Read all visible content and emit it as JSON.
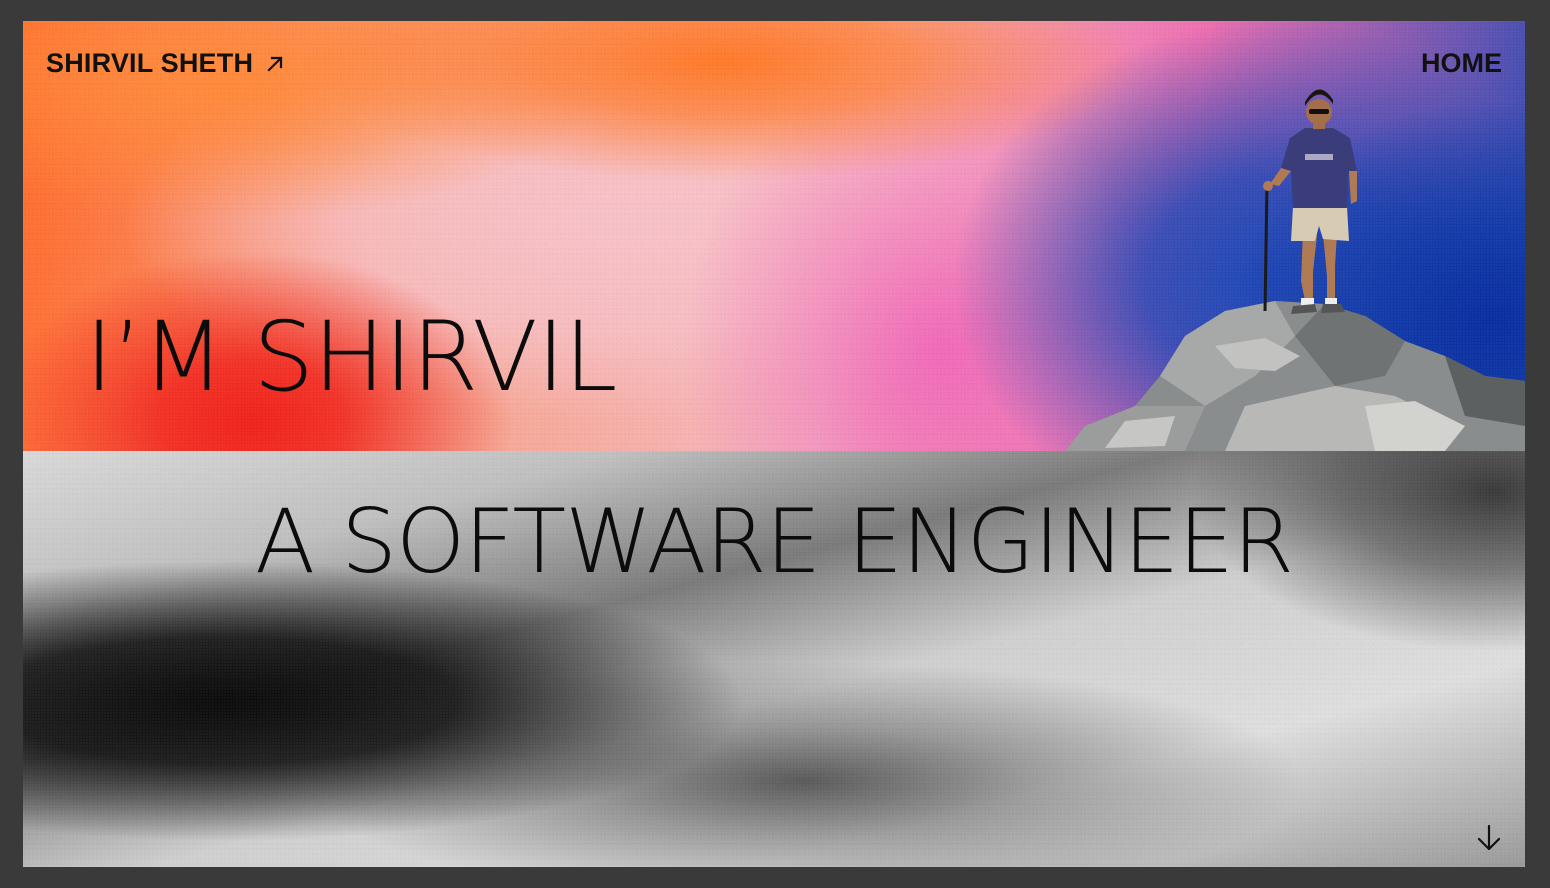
{
  "header": {
    "brand_name": "SHIRVIL SHETH",
    "brand_icon": "arrow-up-right-icon",
    "nav": [
      {
        "label": "HOME"
      }
    ]
  },
  "hero": {
    "line1": "I’M SHIRVIL",
    "line2": "A SOFTWARE ENGINEER",
    "photo": "person-standing-on-rock-with-hiking-pole",
    "scroll_icon": "arrow-down-icon"
  },
  "colors": {
    "frame": "#3a3a3a",
    "orange": "#ff7a2a",
    "red": "#f0231c",
    "pink": "#f5b9c2",
    "magenta": "#ee6fb0",
    "blue": "#1e48b6",
    "text": "#0c0c0c"
  }
}
